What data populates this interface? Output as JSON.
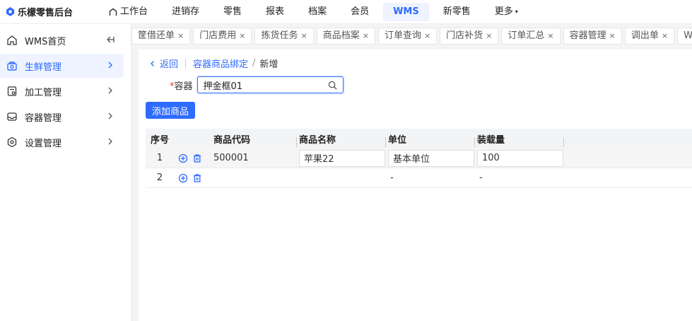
{
  "app": {
    "logo_text": "乐檬零售后台"
  },
  "topnav": [
    {
      "label": "工作台",
      "icon": "home-icon"
    },
    {
      "label": "进销存"
    },
    {
      "label": "零售"
    },
    {
      "label": "报表"
    },
    {
      "label": "档案"
    },
    {
      "label": "会员"
    },
    {
      "label": "WMS",
      "active": true
    },
    {
      "label": "新零售"
    },
    {
      "label": "更多",
      "caret": "▾"
    }
  ],
  "sidebar": {
    "items": [
      {
        "label": "WMS首页",
        "icon": "home-icon",
        "right": "collapse-icon"
      },
      {
        "label": "生鲜管理",
        "icon": "fresh-icon",
        "active": true
      },
      {
        "label": "加工管理",
        "icon": "process-icon"
      },
      {
        "label": "容器管理",
        "icon": "container-icon"
      },
      {
        "label": "设置管理",
        "icon": "settings-icon"
      }
    ]
  },
  "tabs": [
    {
      "label": "筐借还单",
      "close": "×"
    },
    {
      "label": "门店费用",
      "close": "×"
    },
    {
      "label": "拣货任务",
      "close": "×"
    },
    {
      "label": "商品档案",
      "close": "×"
    },
    {
      "label": "订单查询",
      "close": "×"
    },
    {
      "label": "门店补货",
      "close": "×"
    },
    {
      "label": "订单汇总",
      "close": "×"
    },
    {
      "label": "容器管理",
      "close": "×"
    },
    {
      "label": "调出单",
      "close": "×"
    },
    {
      "label": "WMS首页",
      "close": "×"
    }
  ],
  "breadcrumb": {
    "back": "返回",
    "parent": "容器商品绑定",
    "slash": "/",
    "current": "新增"
  },
  "form": {
    "required_mark": "*",
    "container_label": "容器",
    "container_value": "押金框01"
  },
  "buttons": {
    "add_product": "添加商品"
  },
  "grid": {
    "headers": {
      "no": "序号",
      "code": "商品代码",
      "name": "商品名称",
      "unit": "单位",
      "capacity": "装载量"
    },
    "rows": [
      {
        "no": "1",
        "code": "500001",
        "name": "苹果22",
        "unit": "基本单位",
        "capacity": "100"
      },
      {
        "no": "2",
        "code": "",
        "name": "",
        "unit": "-",
        "capacity": "-"
      }
    ]
  },
  "colors": {
    "accent": "#2f6bff",
    "required": "#e53935"
  }
}
